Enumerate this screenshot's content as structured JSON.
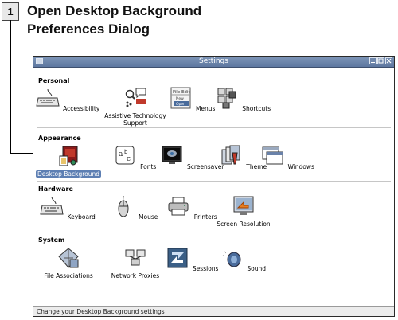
{
  "callout": {
    "step_number": "1",
    "title_line1": "Open Desktop Background",
    "title_line2": "Preferences Dialog"
  },
  "window": {
    "title": "Settings",
    "controls": [
      "minimize",
      "maximize",
      "close"
    ]
  },
  "sections": [
    {
      "heading": "Personal",
      "items": [
        {
          "label": "Accessibility",
          "icon": "keyboard-icon"
        },
        {
          "label": "Assistive Technology",
          "label2": "Support",
          "icon": "assistive-technology-icon"
        },
        {
          "label": "Menus",
          "icon": "menus-icon",
          "menu_lines": [
            "File Edit",
            "New",
            "Open"
          ]
        },
        {
          "label": "Shortcuts",
          "icon": "shortcuts-icon"
        }
      ]
    },
    {
      "heading": "Appearance",
      "items": [
        {
          "label": "Desktop Background",
          "icon": "desktop-background-icon",
          "selected": true
        },
        {
          "label": "Fonts",
          "icon": "fonts-icon"
        },
        {
          "label": "Screensaver",
          "icon": "screensaver-icon"
        },
        {
          "label": "Theme",
          "icon": "theme-icon"
        },
        {
          "label": "Windows",
          "icon": "windows-icon"
        }
      ]
    },
    {
      "heading": "Hardware",
      "items": [
        {
          "label": "Keyboard",
          "icon": "keyboard-icon"
        },
        {
          "label": "Mouse",
          "icon": "mouse-icon"
        },
        {
          "label": "Printers",
          "icon": "printer-icon"
        },
        {
          "label": "Screen Resolution",
          "icon": "screen-resolution-icon"
        }
      ]
    },
    {
      "heading": "System",
      "items": [
        {
          "label": "File Associations",
          "icon": "file-associations-icon"
        },
        {
          "label": "Network Proxies",
          "icon": "network-proxies-icon"
        },
        {
          "label": "Sessions",
          "icon": "sessions-icon"
        },
        {
          "label": "Sound",
          "icon": "sound-icon"
        }
      ]
    }
  ],
  "statusbar": {
    "text": "Change your Desktop Background settings"
  },
  "colors": {
    "titlebar": "#6a82a9",
    "selection": "#5d7fb3"
  }
}
